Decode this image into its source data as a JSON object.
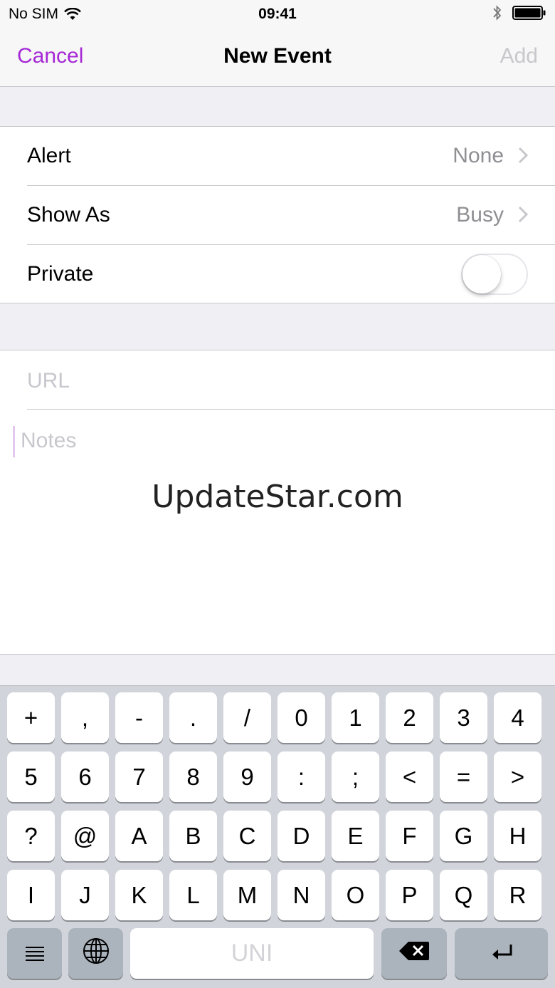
{
  "status_bar": {
    "carrier": "No SIM",
    "time": "09:41"
  },
  "nav": {
    "cancel_label": "Cancel",
    "title": "New Event",
    "add_label": "Add"
  },
  "settings": {
    "alert": {
      "label": "Alert",
      "value": "None"
    },
    "show_as": {
      "label": "Show As",
      "value": "Busy"
    },
    "private": {
      "label": "Private",
      "enabled": false
    }
  },
  "fields": {
    "url_placeholder": "URL",
    "notes_placeholder": "Notes"
  },
  "watermark": "UpdateStar.com",
  "keyboard": {
    "rows": [
      [
        "+",
        ",",
        "-",
        ".",
        "/",
        "0",
        "1",
        "2",
        "3",
        "4"
      ],
      [
        "5",
        "6",
        "7",
        "8",
        "9",
        ":",
        ";",
        "<",
        "=",
        ">"
      ],
      [
        "?",
        "@",
        "A",
        "B",
        "C",
        "D",
        "E",
        "F",
        "G",
        "H"
      ],
      [
        "I",
        "J",
        "K",
        "L",
        "M",
        "N",
        "O",
        "P",
        "Q",
        "R"
      ]
    ],
    "space_label": "UNI",
    "bottom_icons": [
      "menu-icon",
      "globe-icon",
      "delete-icon",
      "return-icon"
    ]
  },
  "colors": {
    "accent": "#a528d6",
    "disabled": "#c7c7cc",
    "secondary_text": "#8e8e93"
  }
}
